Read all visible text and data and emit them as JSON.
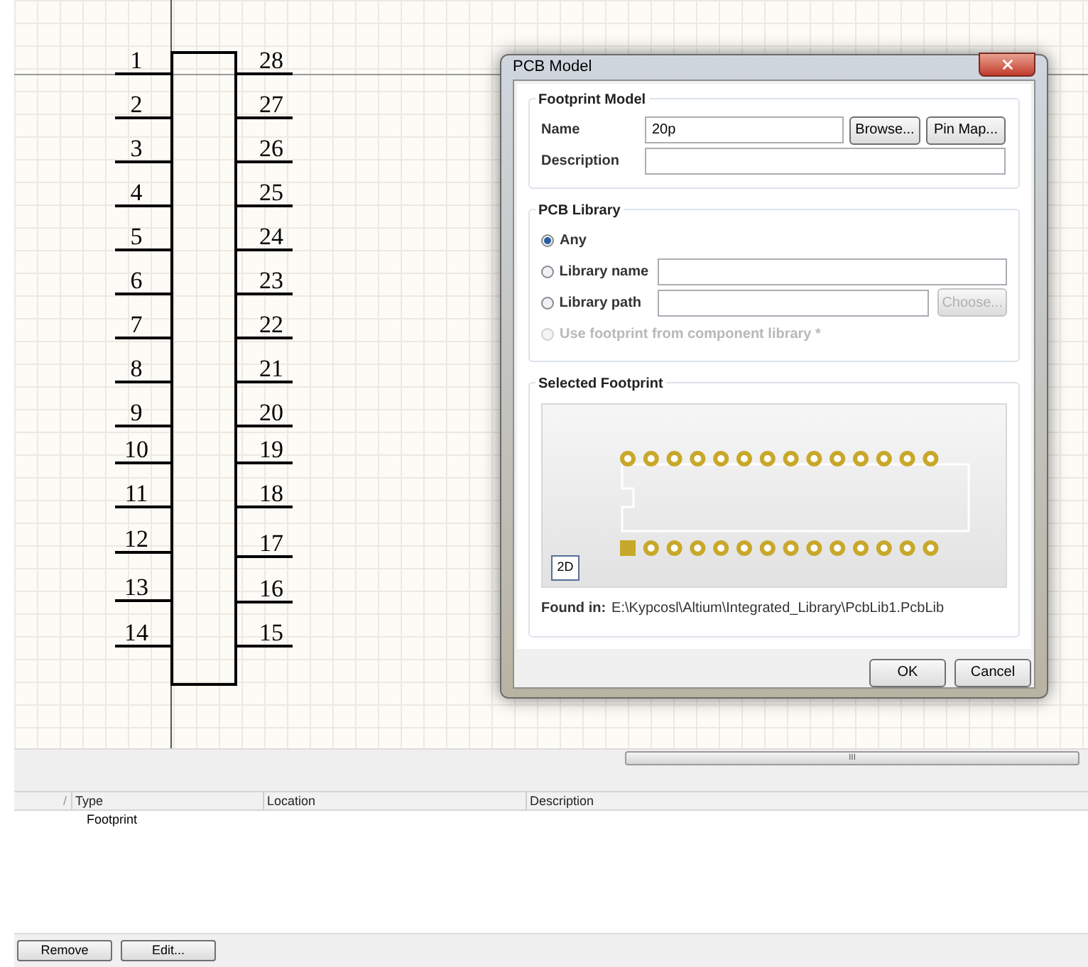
{
  "schematic": {
    "left_pins": [
      "1",
      "2",
      "3",
      "4",
      "5",
      "6",
      "7",
      "8",
      "9",
      "10",
      "11",
      "12",
      "13",
      "14"
    ],
    "right_pins": [
      "28",
      "27",
      "26",
      "25",
      "24",
      "23",
      "22",
      "21",
      "20",
      "19",
      "18",
      "17",
      "16",
      "15"
    ]
  },
  "dialog": {
    "title": "PCB Model",
    "footprint_model": {
      "title": "Footprint Model",
      "name_label": "Name",
      "name_value": "20p",
      "browse": "Browse...",
      "pin_map": "Pin Map...",
      "description_label": "Description"
    },
    "pcb_library": {
      "title": "PCB Library",
      "options": [
        {
          "label": "Any",
          "kind": "plain",
          "selected": true,
          "disabled": false
        },
        {
          "label": "Library name",
          "kind": "field",
          "selected": false,
          "disabled": false
        },
        {
          "label": "Library path",
          "kind": "field_button",
          "selected": false,
          "disabled": false,
          "button": {
            "label": "Choose...",
            "disabled": true
          }
        },
        {
          "label": "Use footprint from component library *",
          "kind": "plain",
          "selected": false,
          "disabled": true
        }
      ]
    },
    "selected_footprint": {
      "title": "Selected Footprint",
      "view_button": "2D",
      "found_label": "Found in:",
      "found_path": "E:\\Kypcosl\\Altium\\Integrated_Library\\PcbLib1.PcbLib"
    },
    "buttons": [
      "OK",
      "Cancel"
    ]
  },
  "models_table": {
    "columns": [
      {
        "label": "Type"
      },
      {
        "label": "Location"
      },
      {
        "label": "Description"
      }
    ],
    "rows": [
      {
        "type": "Footprint"
      }
    ]
  },
  "sort_mark": "/",
  "scrollbar_grip": "III",
  "bottom_buttons": [
    "Remove",
    "Edit..."
  ]
}
